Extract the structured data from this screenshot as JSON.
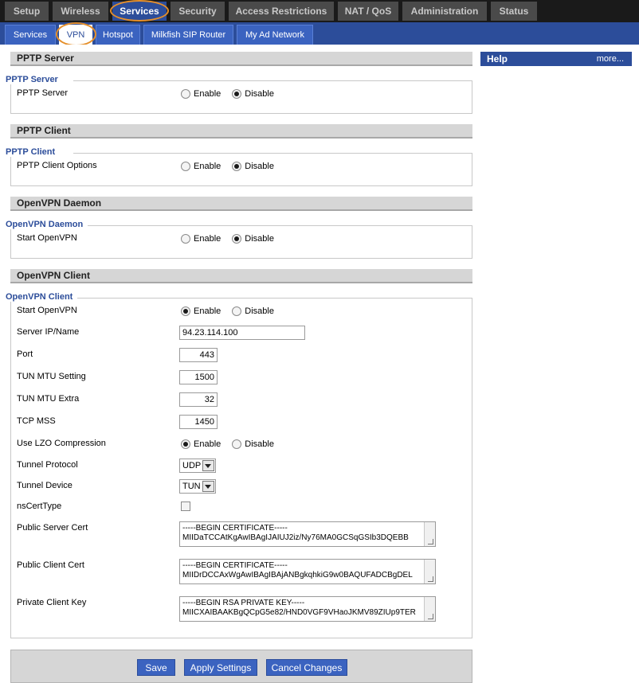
{
  "top_tabs": [
    "Setup",
    "Wireless",
    "Services",
    "Security",
    "Access Restrictions",
    "NAT / QoS",
    "Administration",
    "Status"
  ],
  "sub_tabs": [
    "Services",
    "VPN",
    "Hotspot",
    "Milkfish SIP Router",
    "My Ad Network"
  ],
  "help": {
    "title": "Help",
    "more": "more..."
  },
  "radio": {
    "enable": "Enable",
    "disable": "Disable"
  },
  "pptp_server": {
    "header": "PPTP Server",
    "legend": "PPTP Server",
    "label": "PPTP Server",
    "selected": "Disable"
  },
  "pptp_client": {
    "header": "PPTP Client",
    "legend": "PPTP Client",
    "label": "PPTP Client Options",
    "selected": "Disable"
  },
  "openvpn_daemon": {
    "header": "OpenVPN Daemon",
    "legend": "OpenVPN Daemon",
    "label": "Start OpenVPN",
    "selected": "Disable"
  },
  "openvpn_client": {
    "header": "OpenVPN Client",
    "legend": "OpenVPN Client",
    "start_label": "Start OpenVPN",
    "start_selected": "Enable",
    "server_label": "Server IP/Name",
    "server_value": "94.23.114.100",
    "port_label": "Port",
    "port_value": "443",
    "tun_mtu_label": "TUN MTU Setting",
    "tun_mtu_value": "1500",
    "tun_mtu_extra_label": "TUN MTU Extra",
    "tun_mtu_extra_value": "32",
    "tcp_mss_label": "TCP MSS",
    "tcp_mss_value": "1450",
    "lzo_label": "Use LZO Compression",
    "lzo_selected": "Enable",
    "protocol_label": "Tunnel Protocol",
    "protocol_value": "UDP",
    "device_label": "Tunnel Device",
    "device_value": "TUN",
    "nscerttype_label": "nsCertType",
    "nscerttype_checked": false,
    "server_cert_label": "Public Server Cert",
    "server_cert_line1": "-----BEGIN CERTIFICATE-----",
    "server_cert_line2": "MIIDaTCCAtKgAwIBAgIJAIUJ2iz/Ny76MA0GCSqGSIb3DQEBB",
    "client_cert_label": "Public Client Cert",
    "client_cert_line1": "-----BEGIN CERTIFICATE-----",
    "client_cert_line2": "MIIDrDCCAxWgAwIBAgIBAjANBgkqhkiG9w0BAQUFADCBgDEL",
    "client_key_label": "Private Client Key",
    "client_key_line1": "-----BEGIN RSA PRIVATE KEY-----",
    "client_key_line2": "MIICXAIBAAKBgQCpG5e82/HND0VGF9VHaoJKMV89ZIUp9TER"
  },
  "buttons": {
    "save": "Save",
    "apply": "Apply Settings",
    "cancel": "Cancel Changes"
  }
}
